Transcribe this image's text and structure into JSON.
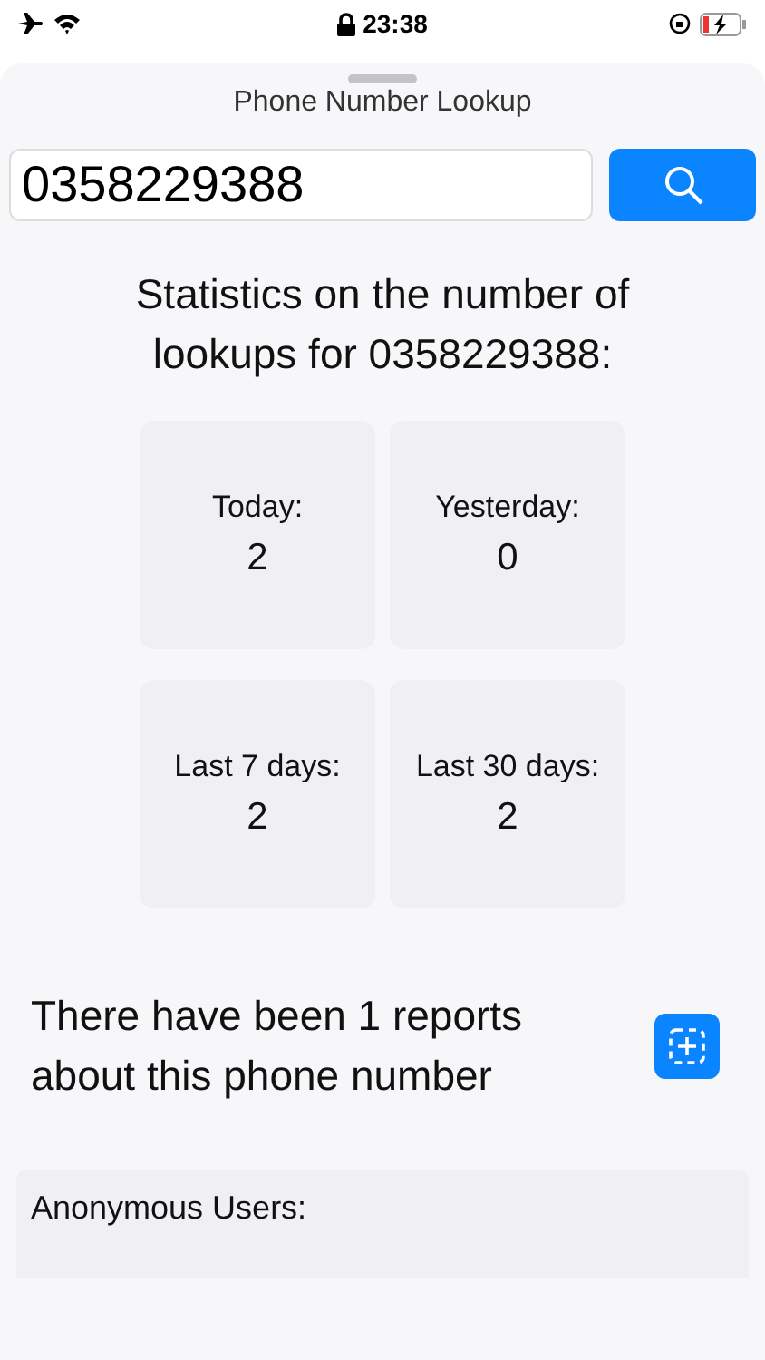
{
  "status_bar": {
    "time": "23:38"
  },
  "sheet": {
    "title": "Phone Number Lookup"
  },
  "search": {
    "value": "0358229388"
  },
  "statistics": {
    "heading": "Statistics on the number of lookups for 0358229388:",
    "cards": [
      {
        "label": "Today:",
        "value": "2"
      },
      {
        "label": "Yesterday:",
        "value": "0"
      },
      {
        "label": "Last 7 days:",
        "value": "2"
      },
      {
        "label": "Last 30 days:",
        "value": "2"
      }
    ]
  },
  "reports": {
    "summary": "There have been 1 reports about this phone number"
  },
  "report_list": [
    {
      "author": "Anonymous Users:"
    }
  ]
}
